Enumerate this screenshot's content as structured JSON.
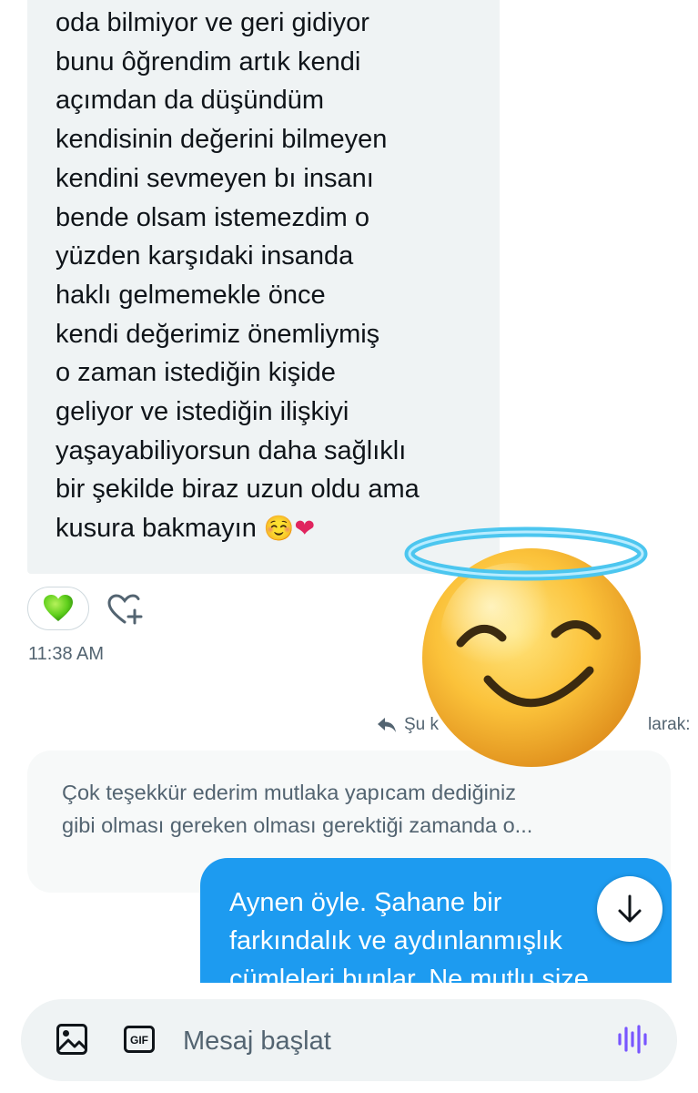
{
  "message_in": {
    "lines": [
      "oda bilmiyor ve geri gidiyor",
      "bunu ôğrendim artık kendi",
      "açımdan da düşündüm",
      "kendisinin değerini bilmeyen",
      "kendini sevmeyen bı insanı",
      "bende olsam istemezdim o",
      "yüzden karşıdaki insanda",
      "haklı gelmemekle önce",
      "kendi değerimiz önemliymiş",
      "o zaman istediğin kişide",
      "geliyor ve istediğin ilişkiyi",
      "yaşayabiliyorsun daha sağlıklı",
      "bir şekilde biraz uzun oldu ama",
      "kusura bakmayın"
    ],
    "trailing_emojis": "☺️",
    "trailing_heart": "❤",
    "reaction_emoji": "green-heart",
    "time": "11:38 AM"
  },
  "reply": {
    "label_start": "Şu k",
    "label_end": "larak:",
    "quote_lines": [
      "Çok teşekkür ederim mutlaka yapıcam dediğiniz",
      "gibi olması gereken olması gerektiği zamanda o..."
    ]
  },
  "message_out": {
    "lines": [
      "Aynen öyle. Şahane bir",
      "farkındalık ve aydınlanmışlık",
      "cümleleri bunlar. Ne mutlu size"
    ]
  },
  "composer": {
    "placeholder": "Mesaj başlat",
    "gif_label": "GIF"
  },
  "colors": {
    "accent": "#1d9bf0",
    "incoming_bubble": "#eff3f4",
    "secondary_text": "#536471",
    "voice_icon": "#7856ff"
  }
}
